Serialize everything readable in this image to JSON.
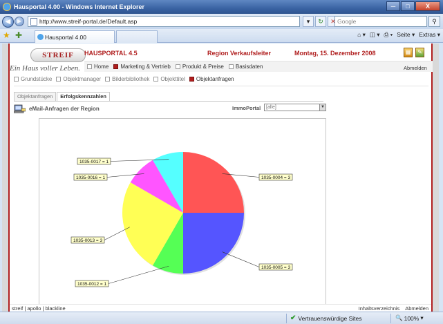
{
  "window": {
    "title": "Hausportal 4.00 - Windows Internet Explorer",
    "min_glyph": "─",
    "max_glyph": "□",
    "close_glyph": "X"
  },
  "address_bar": {
    "url": "http://www.streif-portal.de/Default.asp",
    "search_placeholder": "Google"
  },
  "tabs": [
    {
      "label": "Hausportal 4.00"
    }
  ],
  "command_bar": {
    "page_label": "Seite",
    "extras_label": "Extras"
  },
  "header": {
    "logo_text": "STREIF",
    "slogan": "Ein Haus voller Leben.",
    "title": "HAUSPORTAL 4.5",
    "region": "Region Verkaufsleiter",
    "date": "Montag, 15. Dezember 2008",
    "logout": "Abmelden"
  },
  "main_nav": [
    {
      "label": "Home",
      "checked": false
    },
    {
      "label": "Marketing & Vertrieb",
      "checked": true
    },
    {
      "label": "Produkt & Preise",
      "checked": false
    },
    {
      "label": "Basisdaten",
      "checked": false
    }
  ],
  "sub_nav": [
    {
      "label": "Grundstücke",
      "checked": false
    },
    {
      "label": "Objektmanager",
      "checked": false
    },
    {
      "label": "Bilderbibliothek",
      "checked": false
    },
    {
      "label": "Objekttitel",
      "checked": false
    },
    {
      "label": "Objektanfragen",
      "checked": true
    }
  ],
  "page_tabs": [
    {
      "label": "Objektanfragen",
      "active": false
    },
    {
      "label": "Erfolgskennzahlen",
      "active": true
    }
  ],
  "section": {
    "title": "eMail-Anfragen der Region",
    "filter_label": "ImmoPortal",
    "filter_value": "[alle]"
  },
  "chart_data": {
    "type": "pie",
    "title": "",
    "slices": [
      {
        "label": "1035-0004 = 3",
        "value": 3,
        "color": "#ff5555"
      },
      {
        "label": "1035-0005 = 3",
        "value": 3,
        "color": "#5555ff"
      },
      {
        "label": "1035-0012 = 1",
        "value": 1,
        "color": "#55ff55"
      },
      {
        "label": "1035-0013 = 3",
        "value": 3,
        "color": "#ffff55"
      },
      {
        "label": "1035-0016 = 1",
        "value": 1,
        "color": "#ff55ff"
      },
      {
        "label": "1035-0017 = 1",
        "value": 1,
        "color": "#55ffff"
      }
    ]
  },
  "footer": {
    "left": "streif | apollo | blackline",
    "toc": "Inhaltsverzeichnis",
    "logout": "Abmelden"
  },
  "status_bar": {
    "trusted": "Vertrauenswürdige Sites",
    "zoom": "100%"
  }
}
